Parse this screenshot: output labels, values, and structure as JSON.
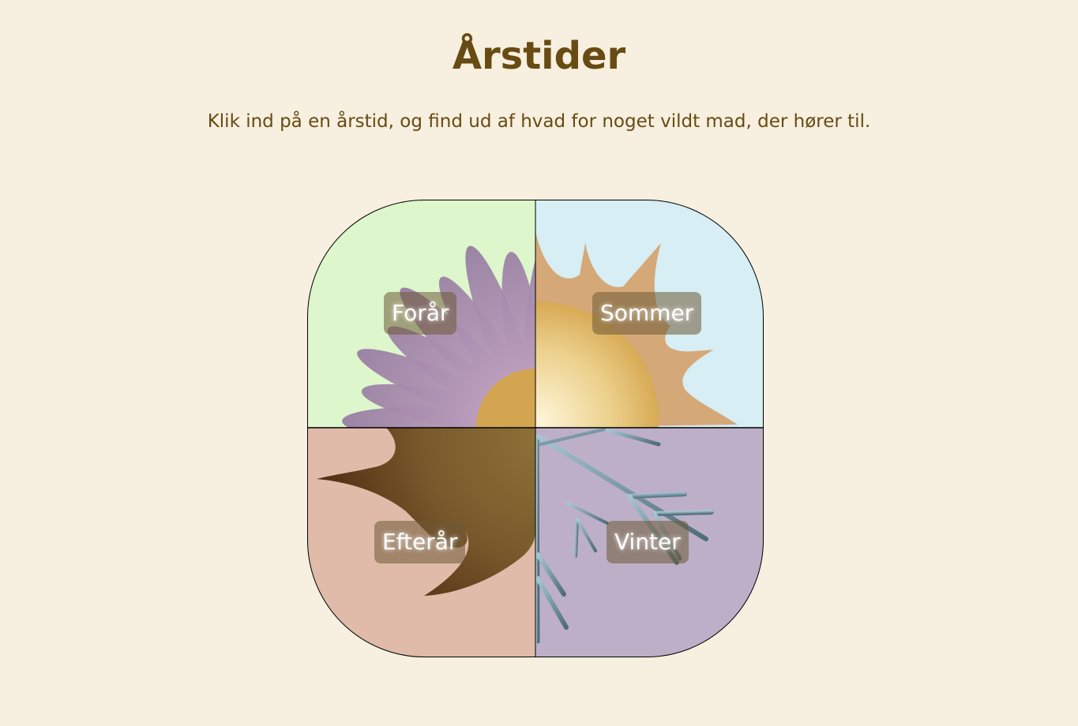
{
  "header": {
    "title": "Årstider",
    "subtitle": "Klik ind på en årstid, og find ud af hvad for noget vildt mad, der hører til."
  },
  "seasons": [
    {
      "key": "spring",
      "label": "Forår",
      "bg": "#ddf6cc",
      "icon": "flower-icon"
    },
    {
      "key": "summer",
      "label": "Sommer",
      "bg": "#d6eef4",
      "icon": "sun-icon"
    },
    {
      "key": "autumn",
      "label": "Efterår",
      "bg": "#e0bba9",
      "icon": "leaf-icon"
    },
    {
      "key": "winter",
      "label": "Vinter",
      "bg": "#bdafc8",
      "icon": "frost-branch-icon"
    }
  ],
  "colors": {
    "page_bg": "#f7efdf",
    "title": "#674b12",
    "petal": "#a385ab",
    "flower_center": "#d4a550",
    "sun_rays": "#d5a878",
    "sun_core": "#e8c56a",
    "leaf": "#7a5a2a",
    "branch": "#5f7d88"
  }
}
